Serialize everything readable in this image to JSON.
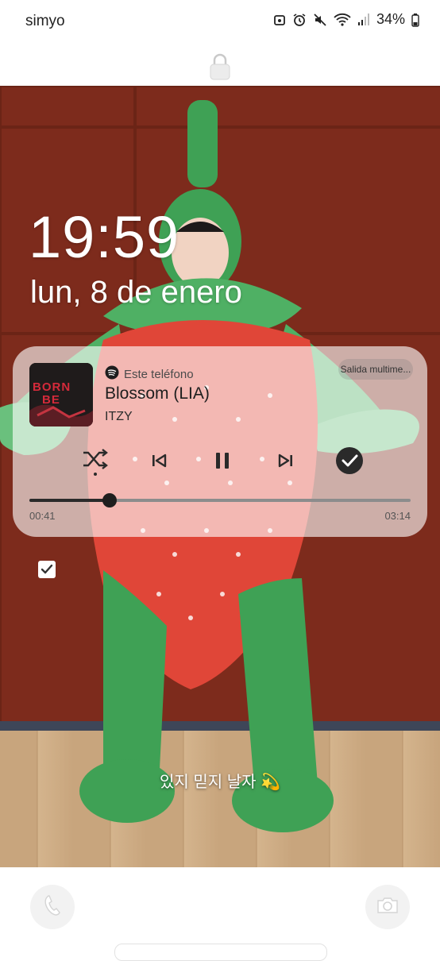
{
  "status": {
    "carrier": "simyo",
    "battery": "34%"
  },
  "lockscreen": {
    "time": "19:59",
    "date": "lun, 8 de enero"
  },
  "media": {
    "source": "Este teléfono",
    "output_button": "Salida multime...",
    "title": "Blossom (LIA)",
    "artist": "ITZY",
    "album_text_line1": "BORN",
    "album_text_line2": "BE",
    "elapsed": "00:41",
    "duration": "03:14",
    "progress_fraction": 0.211
  },
  "caption": "있지 믿지 날자 💫",
  "icons": {
    "status": [
      "cast-icon",
      "alarm-icon",
      "mute-icon",
      "wifi-icon",
      "signal-icon",
      "battery-icon"
    ],
    "lock": "lock-icon",
    "media_controls": [
      "shuffle-icon",
      "previous-icon",
      "pause-icon",
      "next-icon",
      "favorite-check-icon"
    ],
    "shortcuts": [
      "phone-icon",
      "camera-icon"
    ]
  },
  "colors": {
    "accent_dark": "#2a2a2a",
    "spotify": "#1e1e1e",
    "album_red": "#d42a3a"
  }
}
